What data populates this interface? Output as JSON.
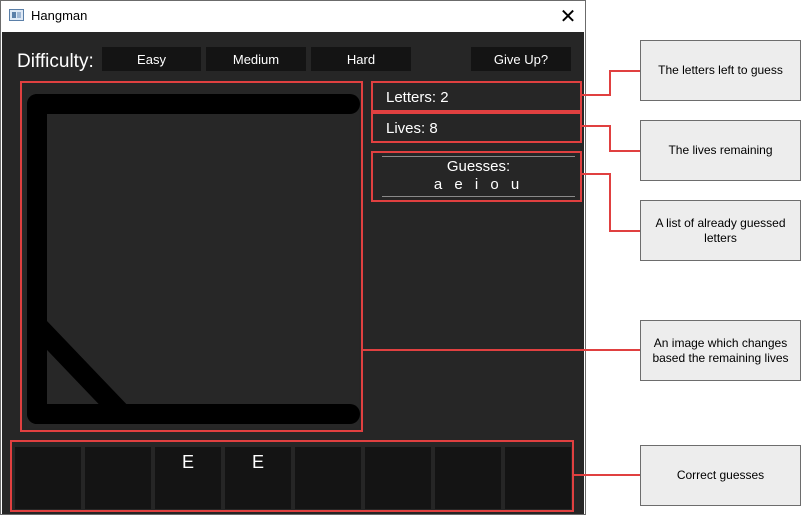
{
  "window": {
    "title": "Hangman",
    "close_glyph": "✕",
    "icon": "app-window-icon"
  },
  "difficulty": {
    "label": "Difficulty:",
    "buttons": [
      {
        "label": "Easy"
      },
      {
        "label": "Medium"
      },
      {
        "label": "Hard"
      }
    ],
    "give_up_label": "Give Up?"
  },
  "status": {
    "letters": "Letters: 2",
    "lives": "Lives: 8",
    "guesses_title": "Guesses:",
    "guesses_letters": "a e i o u"
  },
  "word_slots": [
    "",
    "",
    "E",
    "E",
    "",
    "",
    "",
    ""
  ],
  "callouts": {
    "letters_left": "The letters left to guess",
    "lives_remaining": "The lives remaining",
    "guessed_list": "A list of already guessed letters",
    "image": "An image which changes based the remaining lives",
    "correct": "Correct guesses"
  },
  "colors": {
    "annotation": "#e04040",
    "panel": "#262626",
    "button": "#141414"
  }
}
